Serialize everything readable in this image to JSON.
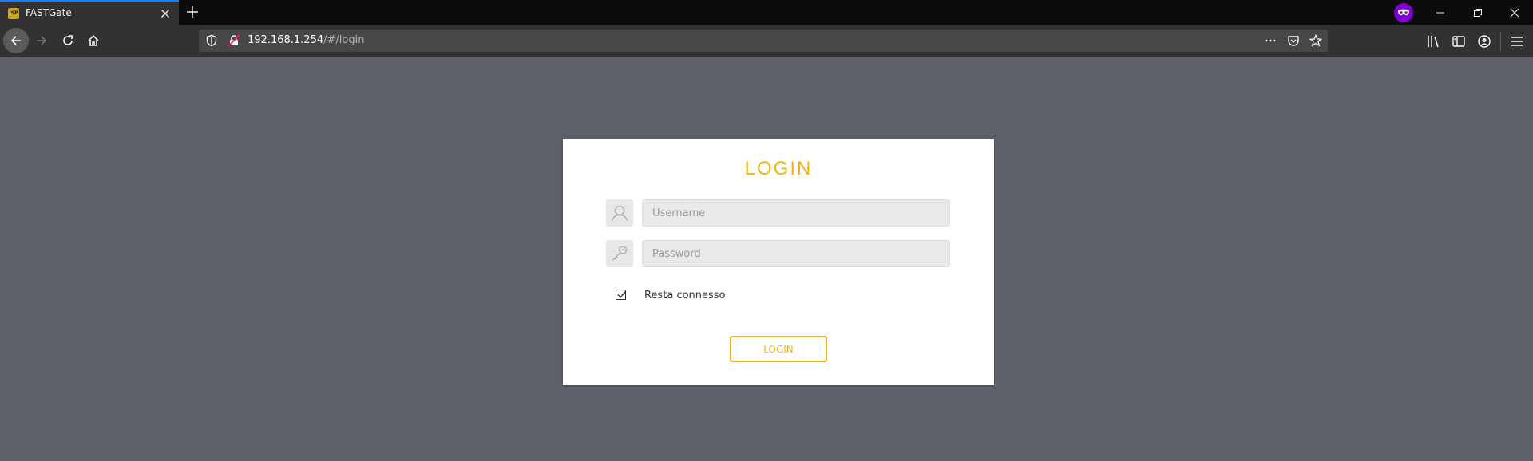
{
  "browser": {
    "tab_title": "FASTGate",
    "favicon_text": "ISP",
    "url_host": "192.168.1.254",
    "url_path": "/#/login",
    "accent_color": "#0a84ff",
    "private_color": "#8000d7"
  },
  "login": {
    "title": "LOGIN",
    "username_placeholder": "Username",
    "password_placeholder": "Password",
    "remember_label": "Resta connesso",
    "remember_checked": true,
    "button_label": "LOGIN",
    "accent_color": "#f5b20c"
  },
  "icons": {
    "username": "user-icon",
    "password": "key-icon"
  }
}
